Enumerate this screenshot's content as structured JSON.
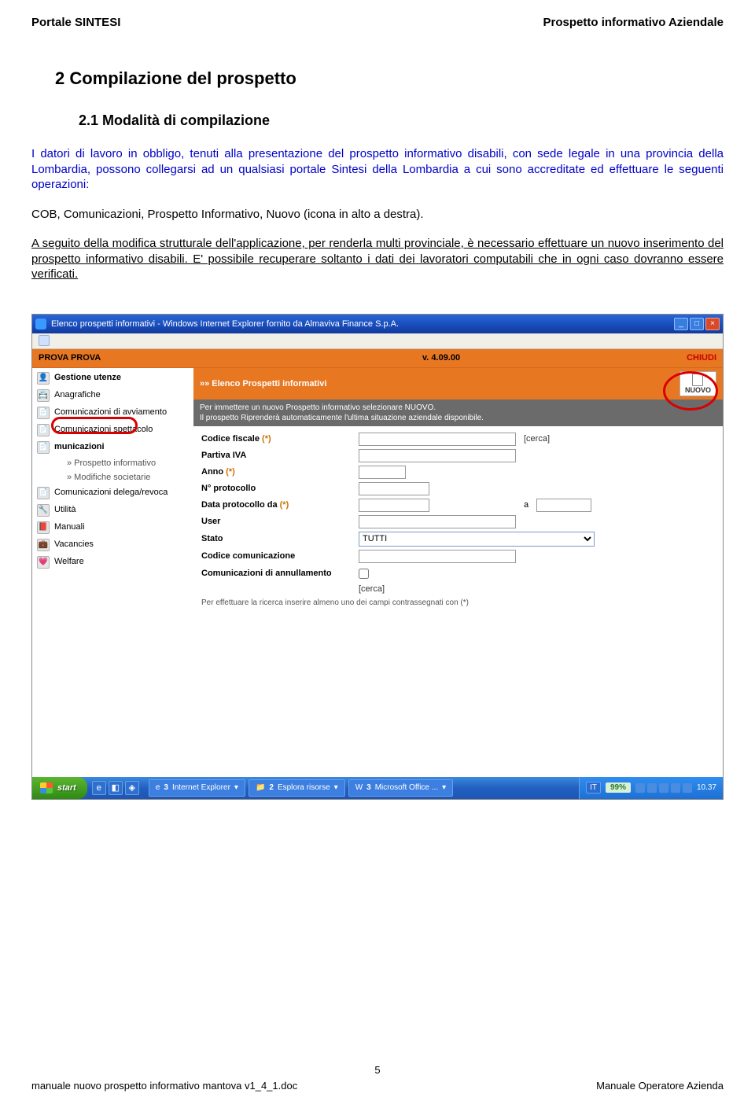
{
  "header": {
    "left": "Portale SINTESI",
    "right": "Prospetto informativo Aziendale"
  },
  "section_title": "2  Compilazione del prospetto",
  "subsection_title": "2.1 Modalità di compilazione",
  "para_intro": "I datori di lavoro in obbligo, tenuti alla presentazione del prospetto informativo disabili, con sede legale in una provincia della Lombardia, possono collegarsi ad un qualsiasi portale Sintesi della Lombardia a cui sono accreditate ed effettuare le seguenti operazioni:",
  "para_cob": "COB, Comunicazioni, Prospetto Informativo, Nuovo (icona in alto a destra).",
  "para_underline": "A seguito della modifica strutturale dell'applicazione, per renderla multi provinciale, è necessario effettuare un nuovo inserimento del prospetto informativo disabili. E' possibile recuperare soltanto i dati dei lavoratori computabili che in ogni caso dovranno essere verificati.",
  "ie": {
    "title": "Elenco prospetti informativi - Windows Internet Explorer fornito da Almaviva Finance S.p.A.",
    "minimize": "_",
    "maximize": "□",
    "close": "×"
  },
  "orange": {
    "left": "PROVA PROVA",
    "center": "v. 4.09.00",
    "right": "CHIUDI"
  },
  "sidebar": {
    "items": [
      {
        "label": "Gestione utenze",
        "bold": true
      },
      {
        "label": "Anagrafiche"
      },
      {
        "label": "Comunicazioni di avviamento"
      },
      {
        "label": "Comunicazioni spettacolo"
      },
      {
        "label": "municazioni",
        "bold": true
      },
      {
        "label": "Utilità"
      },
      {
        "label": "Manuali"
      },
      {
        "label": "Vacancies"
      },
      {
        "label": "Welfare"
      }
    ],
    "subs": [
      {
        "label": "» Prospetto informativo"
      },
      {
        "label": "» Modifiche societarie"
      },
      {
        "label": "Comunicazioni delega/revoca"
      }
    ]
  },
  "main": {
    "header": "»» Elenco Prospetti informativi",
    "nuovo": "NUOVO",
    "instr1": "Per immettere un nuovo Prospetto informativo selezionare NUOVO.",
    "instr2": "Il prospetto Riprenderà automaticamente l'ultima situazione aziendale disponibile.",
    "form": {
      "codice_fiscale": "Codice fiscale",
      "partita_iva": "Partiva IVA",
      "anno": "Anno",
      "n_protocollo": "N° protocollo",
      "data_protocollo": "Data protocollo da",
      "a": "a",
      "user": "User",
      "stato": "Stato",
      "stato_value": "TUTTI",
      "codice_com": "Codice comunicazione",
      "com_annull": "Comunicazioni di annullamento",
      "cerca": "[cerca]",
      "note": "Per effettuare la ricerca inserire almeno uno dei campi contrassegnati con (*)",
      "ast": "(*)"
    }
  },
  "taskbar": {
    "start": "start",
    "tasks": [
      {
        "n": "3",
        "label": "Internet Explorer"
      },
      {
        "n": "2",
        "label": "Esplora risorse"
      },
      {
        "n": "3",
        "label": "Microsoft Office ..."
      }
    ],
    "lang": "IT",
    "battery": "99%",
    "clock": "10.37"
  },
  "footer": {
    "page": "5",
    "left": "manuale nuovo prospetto informativo mantova v1_4_1.doc",
    "right": "Manuale Operatore Azienda"
  }
}
